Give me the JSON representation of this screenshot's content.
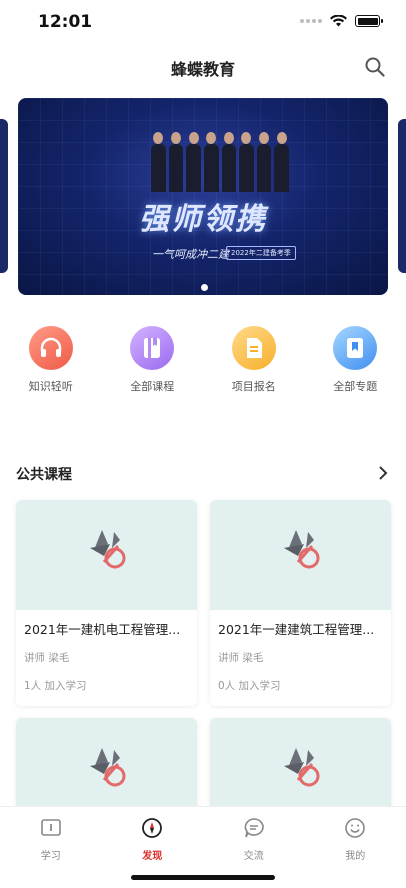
{
  "status_bar": {
    "time": "12:01"
  },
  "header": {
    "title": "蜂蝶教育"
  },
  "banner": {
    "headline": "强师领携",
    "subtitle": "一气呵成冲二建",
    "tag": "2022年二建备考季"
  },
  "quick_entries": [
    {
      "label": "知识轻听",
      "icon": "headphones-icon",
      "color": "#ef5a47"
    },
    {
      "label": "全部课程",
      "icon": "book-icon",
      "color": "#9a6af0"
    },
    {
      "label": "项目报名",
      "icon": "document-icon",
      "color": "#f7b02a"
    },
    {
      "label": "全部专题",
      "icon": "bookmark-icon",
      "color": "#3f8ff0"
    }
  ],
  "public_courses": {
    "title": "公共课程",
    "items": [
      {
        "title": "2021年一建机电工程管理...",
        "teacher": "讲师 梁毛",
        "learners": "1人 加入学习"
      },
      {
        "title": "2021年一建建筑工程管理...",
        "teacher": "讲师 梁毛",
        "learners": "0人 加入学习"
      },
      {
        "title": "",
        "teacher": "",
        "learners": ""
      },
      {
        "title": "",
        "teacher": "",
        "learners": ""
      }
    ]
  },
  "tabbar": {
    "items": [
      {
        "label": "学习",
        "icon": "study-icon"
      },
      {
        "label": "发现",
        "icon": "compass-icon",
        "active": true
      },
      {
        "label": "交流",
        "icon": "chat-icon"
      },
      {
        "label": "我的",
        "icon": "smile-icon"
      }
    ]
  },
  "colors": {
    "accent": "#d9302c",
    "thumb_bg": "#e2f0f0"
  }
}
